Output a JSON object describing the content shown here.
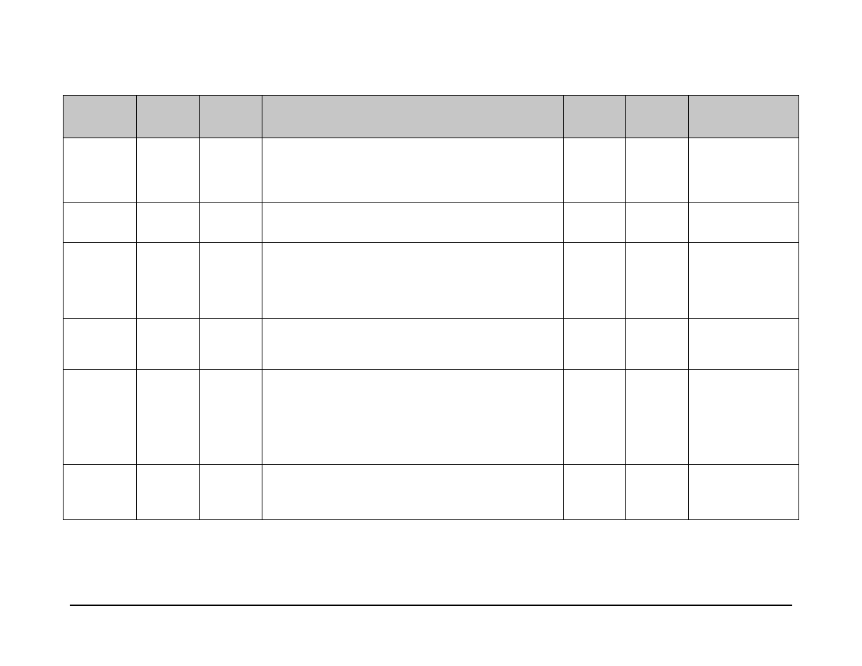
{
  "table": {
    "headers": [
      "",
      "",
      "",
      "",
      "",
      "",
      ""
    ],
    "rows": [
      [
        "",
        "",
        "",
        "",
        "",
        "",
        ""
      ],
      [
        "",
        "",
        "",
        "",
        "",
        "",
        ""
      ],
      [
        "",
        "",
        "",
        "",
        "",
        "",
        ""
      ],
      [
        "",
        "",
        "",
        "",
        "",
        "",
        ""
      ],
      [
        "",
        "",
        "",
        "",
        "",
        "",
        ""
      ],
      [
        "",
        "",
        "",
        "",
        "",
        "",
        ""
      ]
    ]
  }
}
